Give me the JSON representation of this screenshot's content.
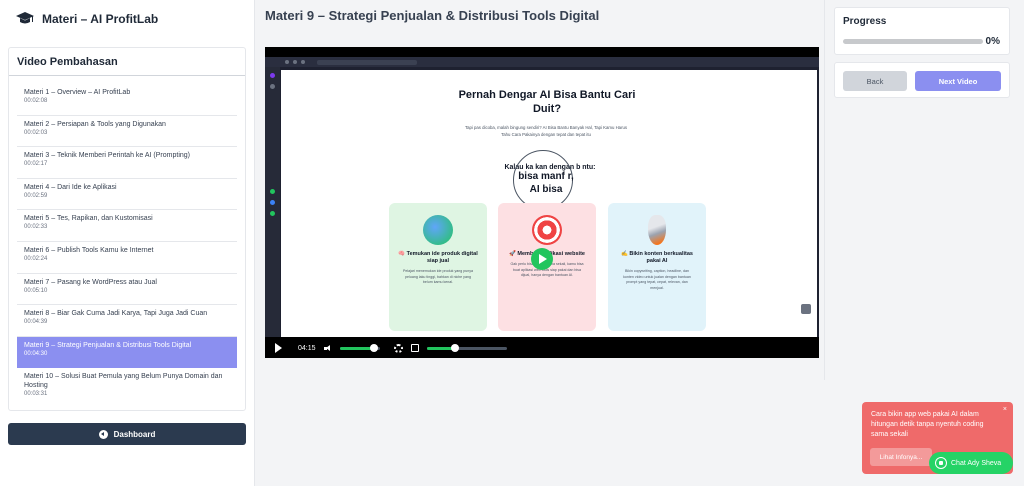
{
  "brand": {
    "title": "Materi – AI ProfitLab"
  },
  "sidebar": {
    "panel_title": "Video Pembahasan",
    "lessons": [
      {
        "title": "Materi 1 – Overview – AI ProfitLab",
        "duration": "00:02:08"
      },
      {
        "title": "Materi 2 – Persiapan & Tools yang Digunakan",
        "duration": "00:02:03"
      },
      {
        "title": "Materi 3 – Teknik Memberi Perintah ke AI (Prompting)",
        "duration": "00:02:17"
      },
      {
        "title": "Materi 4 – Dari Ide ke Aplikasi",
        "duration": "00:02:59"
      },
      {
        "title": "Materi 5 – Tes, Rapikan, dan Kustomisasi",
        "duration": "00:02:33"
      },
      {
        "title": "Materi 6 – Publish Tools Kamu ke Internet",
        "duration": "00:02:24"
      },
      {
        "title": "Materi 7 – Pasang ke WordPress atau Jual",
        "duration": "00:05:10"
      },
      {
        "title": "Materi 8 – Biar Gak Cuma Jadi Karya, Tapi Juga Jadi Cuan",
        "duration": "00:04:39"
      },
      {
        "title": "Materi 9 – Strategi Penjualan & Distribusi Tools Digital",
        "duration": "00:04:30"
      },
      {
        "title": "Materi 10 – Solusi Buat Pemula yang Belum Punya Domain dan Hosting",
        "duration": "00:03:31"
      }
    ],
    "active_index": 8,
    "dashboard_label": "Dashboard"
  },
  "main": {
    "title": "Materi 9 – Strategi Penjualan & Distribusi Tools Digital"
  },
  "video": {
    "url": "cuanviral.com/ai-profitlab",
    "headline": "Pernah Dengar AI Bisa Bantu Cari Duit?",
    "subtext": "Tapi pas dicoba, malah bingung sendiri? AI Bisa Bantu Banyak Hal, Tapi Kamu Harus Tahu Cara Pakainya dengan tepat dan tepat itu",
    "question": "Kalau ka            kan dengan b             ntu:",
    "caption": "bisa manf r, AI bisa",
    "cards": [
      {
        "title": "🧠 Temukan ide produk digital siap jual",
        "desc": "Pelajari menemukan ide produk yang punya peluang laku tinggi, bahkan di niche yang belum kamu kenal.",
        "bg": "#dff5e3"
      },
      {
        "title": "🚀 Membuat aplikasi website",
        "desc": "Gak perlu bisa coding sama sekali, kamu bisa buat aplikasi web tools siap pakai dan bisa dijual, hanya dengan bantuan AI.",
        "bg": "#fde0e3"
      },
      {
        "title": "✍️ Bikin konten berkualitas pakai AI",
        "desc": "Bikin copywriting, caption, headline, dan konten video untuk jualan dengan bantuan prompt yang tepat, cepat, relevan, dan menjual.",
        "bg": "#e1f3fa"
      }
    ],
    "time": "04:15",
    "accent": "#22c55e"
  },
  "progress": {
    "label": "Progress",
    "value": "0%",
    "fraction": 0
  },
  "nav": {
    "back_label": "Back",
    "next_label": "Next Video"
  },
  "promo": {
    "text": "Cara bikin app web pakai AI dalam hitungan detik tanpa nyentuh coding sama sekali",
    "button": "Lihat Infonya...",
    "close": "×",
    "whatsapp": "Chat Ady Sheva"
  }
}
